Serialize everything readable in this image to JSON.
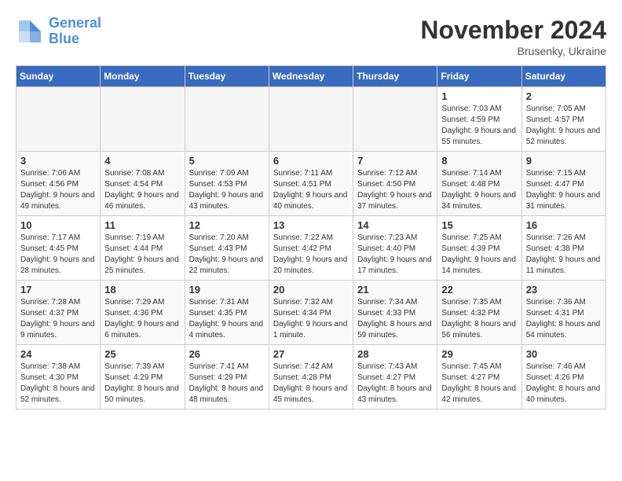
{
  "logo": {
    "name_part1": "General",
    "name_part2": "Blue"
  },
  "title": "November 2024",
  "subtitle": "Brusenky, Ukraine",
  "days_of_week": [
    "Sunday",
    "Monday",
    "Tuesday",
    "Wednesday",
    "Thursday",
    "Friday",
    "Saturday"
  ],
  "weeks": [
    [
      {
        "day": "",
        "info": ""
      },
      {
        "day": "",
        "info": ""
      },
      {
        "day": "",
        "info": ""
      },
      {
        "day": "",
        "info": ""
      },
      {
        "day": "",
        "info": ""
      },
      {
        "day": "1",
        "info": "Sunrise: 7:03 AM\nSunset: 4:59 PM\nDaylight: 9 hours and 55 minutes."
      },
      {
        "day": "2",
        "info": "Sunrise: 7:05 AM\nSunset: 4:57 PM\nDaylight: 9 hours and 52 minutes."
      }
    ],
    [
      {
        "day": "3",
        "info": "Sunrise: 7:06 AM\nSunset: 4:56 PM\nDaylight: 9 hours and 49 minutes."
      },
      {
        "day": "4",
        "info": "Sunrise: 7:08 AM\nSunset: 4:54 PM\nDaylight: 9 hours and 46 minutes."
      },
      {
        "day": "5",
        "info": "Sunrise: 7:09 AM\nSunset: 4:53 PM\nDaylight: 9 hours and 43 minutes."
      },
      {
        "day": "6",
        "info": "Sunrise: 7:11 AM\nSunset: 4:51 PM\nDaylight: 9 hours and 40 minutes."
      },
      {
        "day": "7",
        "info": "Sunrise: 7:12 AM\nSunset: 4:50 PM\nDaylight: 9 hours and 37 minutes."
      },
      {
        "day": "8",
        "info": "Sunrise: 7:14 AM\nSunset: 4:48 PM\nDaylight: 9 hours and 34 minutes."
      },
      {
        "day": "9",
        "info": "Sunrise: 7:15 AM\nSunset: 4:47 PM\nDaylight: 9 hours and 31 minutes."
      }
    ],
    [
      {
        "day": "10",
        "info": "Sunrise: 7:17 AM\nSunset: 4:45 PM\nDaylight: 9 hours and 28 minutes."
      },
      {
        "day": "11",
        "info": "Sunrise: 7:19 AM\nSunset: 4:44 PM\nDaylight: 9 hours and 25 minutes."
      },
      {
        "day": "12",
        "info": "Sunrise: 7:20 AM\nSunset: 4:43 PM\nDaylight: 9 hours and 22 minutes."
      },
      {
        "day": "13",
        "info": "Sunrise: 7:22 AM\nSunset: 4:42 PM\nDaylight: 9 hours and 20 minutes."
      },
      {
        "day": "14",
        "info": "Sunrise: 7:23 AM\nSunset: 4:40 PM\nDaylight: 9 hours and 17 minutes."
      },
      {
        "day": "15",
        "info": "Sunrise: 7:25 AM\nSunset: 4:39 PM\nDaylight: 9 hours and 14 minutes."
      },
      {
        "day": "16",
        "info": "Sunrise: 7:26 AM\nSunset: 4:38 PM\nDaylight: 9 hours and 11 minutes."
      }
    ],
    [
      {
        "day": "17",
        "info": "Sunrise: 7:28 AM\nSunset: 4:37 PM\nDaylight: 9 hours and 9 minutes."
      },
      {
        "day": "18",
        "info": "Sunrise: 7:29 AM\nSunset: 4:36 PM\nDaylight: 9 hours and 6 minutes."
      },
      {
        "day": "19",
        "info": "Sunrise: 7:31 AM\nSunset: 4:35 PM\nDaylight: 9 hours and 4 minutes."
      },
      {
        "day": "20",
        "info": "Sunrise: 7:32 AM\nSunset: 4:34 PM\nDaylight: 9 hours and 1 minute."
      },
      {
        "day": "21",
        "info": "Sunrise: 7:34 AM\nSunset: 4:33 PM\nDaylight: 8 hours and 59 minutes."
      },
      {
        "day": "22",
        "info": "Sunrise: 7:35 AM\nSunset: 4:32 PM\nDaylight: 8 hours and 56 minutes."
      },
      {
        "day": "23",
        "info": "Sunrise: 7:36 AM\nSunset: 4:31 PM\nDaylight: 8 hours and 54 minutes."
      }
    ],
    [
      {
        "day": "24",
        "info": "Sunrise: 7:38 AM\nSunset: 4:30 PM\nDaylight: 8 hours and 52 minutes."
      },
      {
        "day": "25",
        "info": "Sunrise: 7:39 AM\nSunset: 4:29 PM\nDaylight: 8 hours and 50 minutes."
      },
      {
        "day": "26",
        "info": "Sunrise: 7:41 AM\nSunset: 4:29 PM\nDaylight: 8 hours and 48 minutes."
      },
      {
        "day": "27",
        "info": "Sunrise: 7:42 AM\nSunset: 4:28 PM\nDaylight: 8 hours and 45 minutes."
      },
      {
        "day": "28",
        "info": "Sunrise: 7:43 AM\nSunset: 4:27 PM\nDaylight: 8 hours and 43 minutes."
      },
      {
        "day": "29",
        "info": "Sunrise: 7:45 AM\nSunset: 4:27 PM\nDaylight: 8 hours and 42 minutes."
      },
      {
        "day": "30",
        "info": "Sunrise: 7:46 AM\nSunset: 4:26 PM\nDaylight: 8 hours and 40 minutes."
      }
    ]
  ]
}
